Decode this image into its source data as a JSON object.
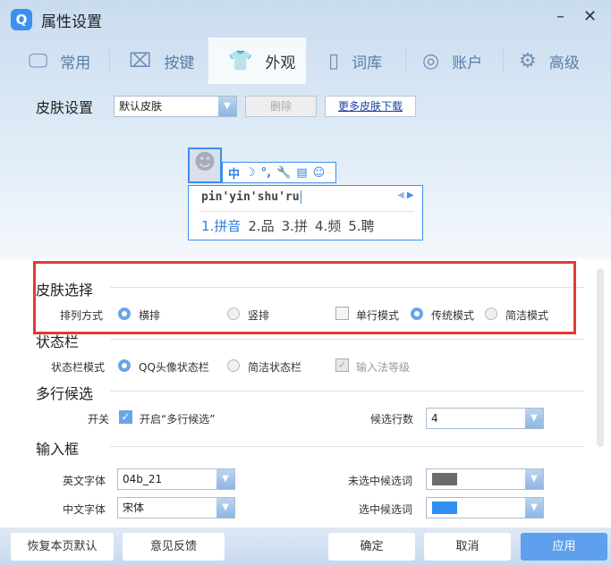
{
  "window": {
    "logo": "Q",
    "title": "属性设置",
    "minimize": "–",
    "close": "✕"
  },
  "tabs": [
    {
      "label": "常用",
      "icon": "monitor-icon"
    },
    {
      "label": "按键",
      "icon": "key-icon"
    },
    {
      "label": "外观",
      "icon": "tshirt-icon"
    },
    {
      "label": "词库",
      "icon": "book-icon"
    },
    {
      "label": "账户",
      "icon": "user-icon"
    },
    {
      "label": "高级",
      "icon": "gear-icon"
    }
  ],
  "skin": {
    "label": "皮肤设置",
    "value": "默认皮肤",
    "delete": "删除",
    "more": "更多皮肤下载"
  },
  "preview": {
    "toolbar": [
      "中",
      "☽",
      "°,",
      "🔧",
      "▤",
      "☺"
    ],
    "composition": "pin'yin'shu'ru",
    "candidates": [
      "1.拼音",
      "2.品",
      "3.拼",
      "4.频",
      "5.聘"
    ]
  },
  "skin_select": {
    "title": "皮肤选择",
    "arrange_label": "排列方式",
    "horizontal": "横排",
    "vertical": "竖排",
    "single_line": "单行模式",
    "traditional": "传统模式",
    "simple": "简洁模式"
  },
  "status_bar": {
    "title": "状态栏",
    "mode_label": "状态栏模式",
    "qq_avatar": "QQ头像状态栏",
    "simple": "简洁状态栏",
    "level": "输入法等级"
  },
  "multi": {
    "title": "多行候选",
    "switch_label": "开关",
    "enable": "开启“多行候选”",
    "rows_label": "候选行数",
    "rows_value": "4"
  },
  "input_box": {
    "title": "输入框",
    "en_font_label": "英文字体",
    "en_font": "04b_21",
    "cn_font_label": "中文字体",
    "cn_font": "宋体",
    "unselected_label": "未选中候选词",
    "unselected_color": "#6b6b6b",
    "selected_label": "选中候选词",
    "selected_color": "#2f8ef0"
  },
  "footer": {
    "restore": "恢复本页默认",
    "feedback": "意见反馈",
    "ok": "确定",
    "cancel": "取消",
    "apply": "应用"
  }
}
